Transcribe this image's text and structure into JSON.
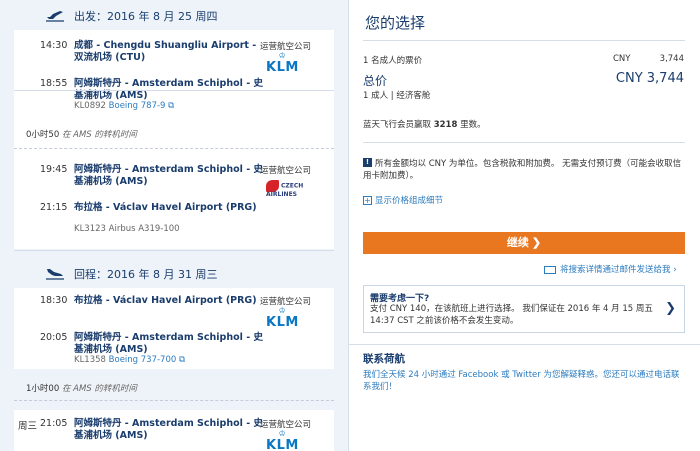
{
  "outbound": {
    "header": "出发：2016 年 8 月 25 周四",
    "segments": [
      {
        "dep_time": "14:30",
        "dep_place": "成都 - Chengdu Shuangliu Airport - 双流机场 (CTU)",
        "arr_time": "18:55",
        "arr_place": "阿姆斯特丹 - Amsterdam Schiphol - 史基浦机场 (AMS)",
        "flight_no": "KL0892",
        "aircraft": "Boeing 787-9",
        "carrier_label": "运营航空公司",
        "carrier": "KLM"
      },
      {
        "dep_time": "19:45",
        "dep_place": "阿姆斯特丹 - Amsterdam Schiphol - 史基浦机场 (AMS)",
        "arr_time": "21:15",
        "arr_place": "布拉格 - Václav Havel Airport (PRG)",
        "flight_no": "KL3123",
        "aircraft": "Airbus A319-100",
        "carrier_label": "运营航空公司",
        "carrier": "CZECH AIRLINES"
      }
    ],
    "layover": {
      "duration": "0小时50",
      "text": "在 AMS 的转机时间"
    }
  },
  "return": {
    "header": "回程：2016 年 8 月 31 周三",
    "segments": [
      {
        "dep_time": "18:30",
        "dep_place": "布拉格 - Václav Havel Airport (PRG)",
        "arr_time": "20:05",
        "arr_place": "阿姆斯特丹 - Amsterdam Schiphol - 史基浦机场 (AMS)",
        "flight_no": "KL1358",
        "aircraft": "Boeing 737-700",
        "carrier_label": "运营航空公司",
        "carrier": "KLM"
      },
      {
        "day": "周三",
        "dep_time": "21:05",
        "dep_place": "阿姆斯特丹 - Amsterdam Schiphol - 史基浦机场 (AMS)",
        "carrier_label": "运营航空公司",
        "carrier": "KLM"
      }
    ],
    "layover": {
      "duration": "1小时00",
      "text": "在 AMS 的转机时间"
    }
  },
  "summary": {
    "title": "您的选择",
    "adult_fare_label": "1 名成人的票价",
    "adult_fare_currency": "CNY",
    "adult_fare_value": "3,744",
    "total_label": "总价",
    "total_value": "CNY 3,744",
    "total_sub": "1 成人 | 经济客舱",
    "miles_prefix": "蓝天飞行会员赢取 ",
    "miles_value": "3218",
    "miles_suffix": " 里数。",
    "info_text": "所有金额均以 CNY 为单位。包含税款和附加费。 无需支付预订费（可能会收取信用卡附加费）。",
    "price_details_link": "显示价格组成细节",
    "continue_button": "继续",
    "email_link": "将搜索详情通过邮件发送给我",
    "notice_title": "需要考虑一下?",
    "notice_body": "支付 CNY 140，在该航班上进行选择。 我们保证在 2016 年 4 月 15 周五 14:37 CST 之前该价格不会发生变动。",
    "contact_title": "联系荷航",
    "contact_body": "我们全天候 24 小时通过 Facebook 或 Twitter 为您解疑释惑。您还可以通过电话联系我们！"
  },
  "colors": {
    "accent": "#e8771f",
    "brand": "#1a3d6d",
    "link": "#2b7bbf",
    "klm": "#0a76c4"
  }
}
